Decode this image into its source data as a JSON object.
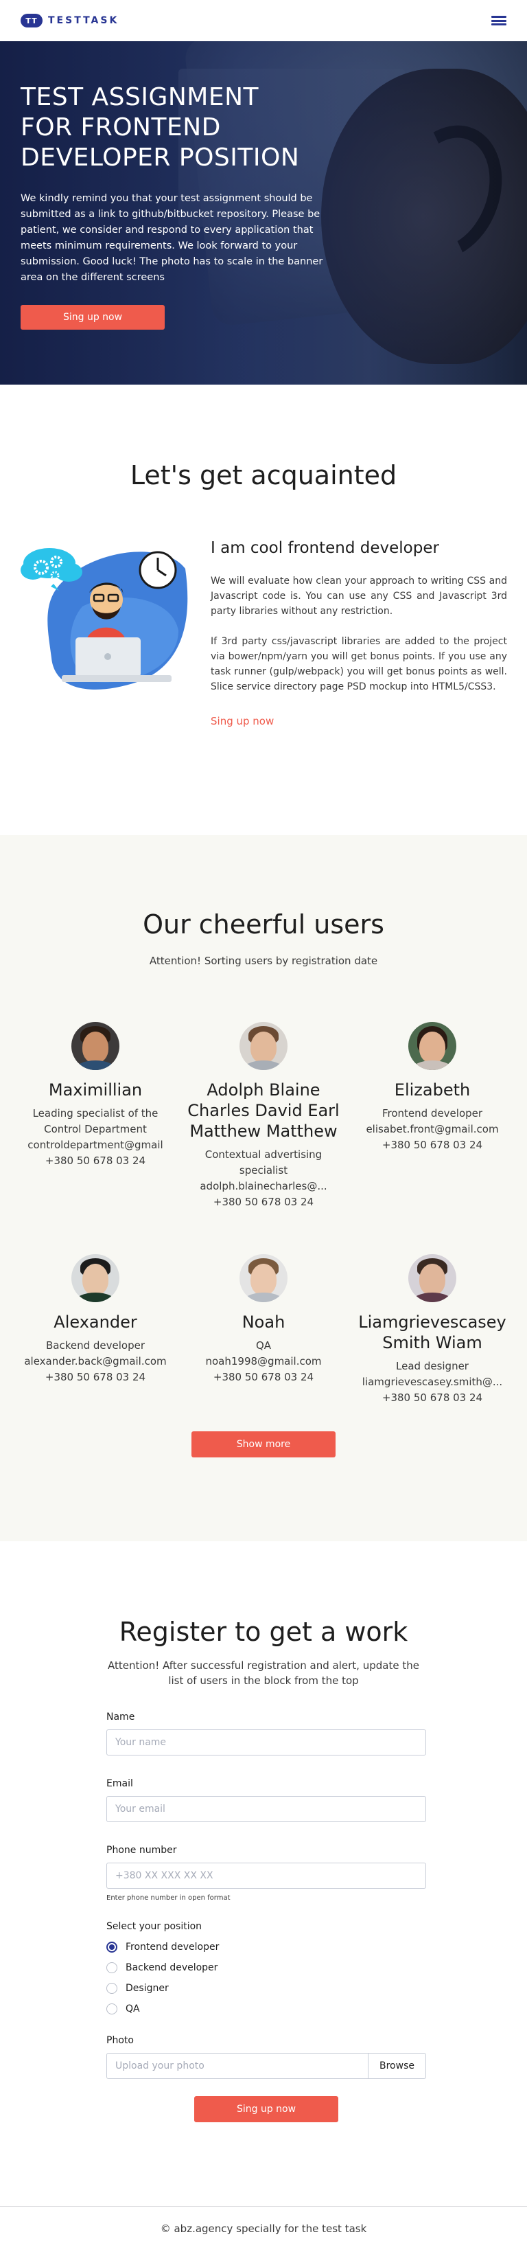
{
  "header": {
    "logo_mark": "TT",
    "logo_text": "TESTTASK",
    "menu_icon": "burger-menu-icon"
  },
  "hero": {
    "title_lines": [
      "TEST ASSIGNMENT",
      "FOR FRONTEND",
      "DEVELOPER POSITION"
    ],
    "text": "We kindly remind you that your test assignment should be submitted as a link to github/bitbucket repository. Please be patient, we consider and respond to every application that meets minimum requirements. We look forward to your submission. Good luck! The photo has to scale in the banner area on the different screens",
    "button": "Sing up now"
  },
  "acquainted": {
    "title": "Let's get acquainted",
    "heading": "I am cool frontend developer",
    "para1": "We will evaluate how clean your approach to writing CSS and Javascript code is. You can use any CSS and Javascript 3rd party libraries without any restriction.",
    "para2": "If 3rd party css/javascript libraries are added to the project via bower/npm/yarn you will get bonus points. If you use any task runner (gulp/webpack) you will get bonus points as well. Slice service directory page PSD mockup into HTML5/CSS3.",
    "link": "Sing up now"
  },
  "users": {
    "title": "Our cheerful users",
    "subtitle": "Attention! Sorting users by registration date",
    "items": [
      {
        "name": "Maximillian",
        "position": "Leading specialist of the Control Department",
        "email": "controldepartment@gmail",
        "phone": "+380 50 678 03 24"
      },
      {
        "name": "Adolph Blaine Charles David Earl Matthew Matthew",
        "position": "Contextual advertising specialist",
        "email": "adolph.blainecharles@...",
        "phone": "+380 50 678 03 24"
      },
      {
        "name": "Elizabeth",
        "position": "Frontend developer",
        "email": "elisabet.front@gmail.com",
        "phone": "+380 50 678 03 24"
      },
      {
        "name": "Alexander",
        "position": "Backend developer",
        "email": "alexander.back@gmail.com",
        "phone": "+380 50 678 03 24"
      },
      {
        "name": "Noah",
        "position": "QA",
        "email": "noah1998@gmail.com",
        "phone": "+380 50 678 03 24"
      },
      {
        "name": "Liamgrievescasey Smith Wiam",
        "position": "Lead designer",
        "email": "liamgrievescasey.smith@...",
        "phone": "+380 50 678 03 24"
      }
    ],
    "show_more": "Show more"
  },
  "register": {
    "title": "Register to get a work",
    "subtitle": "Attention! After successful registration and alert, update the list of users in the block from the top",
    "name_label": "Name",
    "name_placeholder": "Your name",
    "email_label": "Email",
    "email_placeholder": "Your email",
    "phone_label": "Phone number",
    "phone_placeholder": "+380 XX XXX XX XX",
    "phone_hint": "Enter phone number in open format",
    "position_label": "Select your position",
    "positions": [
      {
        "label": "Frontend developer",
        "checked": true
      },
      {
        "label": "Backend developer",
        "checked": false
      },
      {
        "label": "Designer",
        "checked": false
      },
      {
        "label": "QA",
        "checked": false
      }
    ],
    "photo_label": "Photo",
    "photo_placeholder": "Upload your photo",
    "browse": "Browse",
    "submit": "Sing up now"
  },
  "footer": {
    "text": "© abz.agency specially for the test task"
  },
  "colors": {
    "primary": "#283593",
    "accent": "#ef5b4c",
    "users_bg": "#f8f8f3"
  }
}
